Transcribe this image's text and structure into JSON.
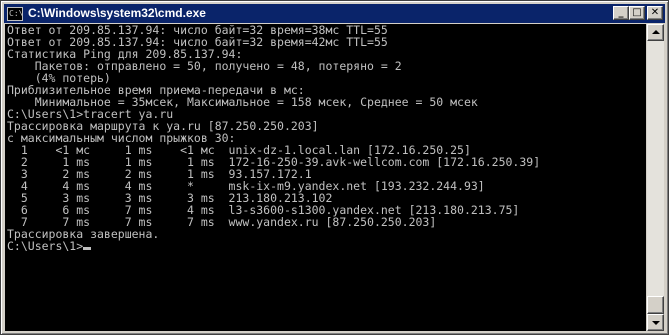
{
  "window": {
    "title": "C:\\Windows\\system32\\cmd.exe",
    "icon_text": "C:\\",
    "buttons": {
      "minimize": "_",
      "maximize": "□",
      "close": "✕"
    }
  },
  "console": {
    "lines": [
      "Ответ от 209.85.137.94: число байт=32 время=38мс TTL=55",
      "Ответ от 209.85.137.94: число байт=32 время=42мс TTL=55",
      "",
      "Статистика Ping для 209.85.137.94:",
      "    Пакетов: отправлено = 50, получено = 48, потеряно = 2",
      "    (4% потерь)",
      "Приблизительное время приема-передачи в мс:",
      "    Минимальное = 35мсек, Максимальное = 158 мсек, Среднее = 50 мсек",
      "",
      "C:\\Users\\1>tracert ya.ru",
      "",
      "Трассировка маршрута к ya.ru [87.250.250.203]",
      "с максимальным числом прыжков 30:",
      "",
      "  1    <1 мс     1 ms    <1 мс  unix-dz-1.local.lan [172.16.250.25]",
      "  2     1 ms     1 ms     1 ms  172-16-250-39.avk-wellcom.com [172.16.250.39]",
      "  3     2 ms     2 ms     1 ms  93.157.172.1",
      "  4     4 ms     4 ms     *     msk-ix-m9.yandex.net [193.232.244.93]",
      "  5     3 ms     3 ms     3 ms  213.180.213.102",
      "  6     6 ms     7 ms     4 ms  l3-s3600-s1300.yandex.net [213.180.213.75]",
      "  7     7 ms     7 ms     7 ms  www.yandex.ru [87.250.250.203]",
      "",
      "Трассировка завершена.",
      ""
    ],
    "prompt": "C:\\Users\\1>"
  },
  "colors": {
    "titlebar": "#0a246a",
    "console_bg": "#000000",
    "console_text": "#c0c0c0",
    "chrome": "#d4d0c8"
  }
}
